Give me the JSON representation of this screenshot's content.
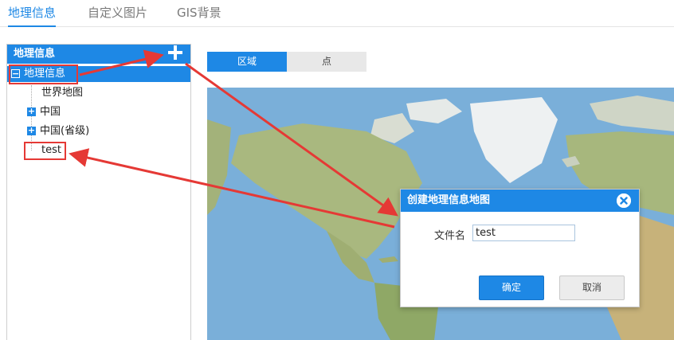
{
  "top_tabs": [
    {
      "label": "地理信息",
      "active": true
    },
    {
      "label": "自定义图片",
      "active": false
    },
    {
      "label": "GIS背景",
      "active": false
    }
  ],
  "sidebar": {
    "title": "地理信息",
    "add_icon": "plus-icon",
    "tree": {
      "root": {
        "label": "地理信息",
        "expander": "−"
      },
      "items": [
        {
          "label": "世界地图"
        },
        {
          "label": "中国",
          "expander": "+"
        },
        {
          "label": "中国(省级)",
          "expander": "+"
        },
        {
          "label": "test"
        }
      ]
    }
  },
  "sub_tabs": [
    {
      "label": "区域",
      "active": true
    },
    {
      "label": "点",
      "active": false
    }
  ],
  "dialog": {
    "title": "创建地理信息地图",
    "field_label": "文件名",
    "field_value": "test",
    "ok_label": "确定",
    "cancel_label": "取消",
    "close_icon": "close-icon"
  },
  "colors": {
    "accent": "#1e88e5",
    "annotation": "#e53935",
    "ocean": "#7aafd9",
    "land": "#a9b87f",
    "ice": "#f2f4f5"
  }
}
